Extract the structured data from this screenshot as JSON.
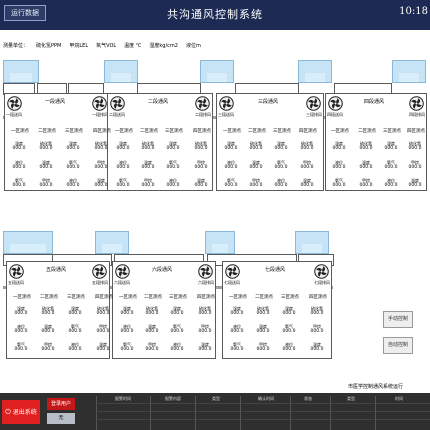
{
  "header": {
    "run_data_label": "运行数据",
    "title": "共沟通风控制系统",
    "clock": "10:18"
  },
  "units": [
    "测量单位：",
    "硫化氢PPM",
    "甲烷LEL",
    "氧气VOL",
    "温度 ℃",
    "湿度kg/cm2",
    "液位m"
  ],
  "top_sections": [
    {
      "title": "一段通风",
      "fan_left": "一段送风",
      "fan_right": "一段排风"
    },
    {
      "title": "二段通风",
      "fan_left": "二段送风",
      "fan_right": "二段排风"
    },
    {
      "title": "三段通风",
      "fan_left": "三段送风",
      "fan_right": "三段排风"
    },
    {
      "title": "四段通风",
      "fan_left": "四段送风",
      "fan_right": "四段排风"
    }
  ],
  "bottom_sections": [
    {
      "title": "五段通风",
      "fan_left": "五段送风",
      "fan_right": "五段排风"
    },
    {
      "title": "六段通风",
      "fan_left": "六段送风",
      "fan_right": "六段排风"
    },
    {
      "title": "七段通风",
      "fan_left": "七段送风",
      "fan_right": "七段排风"
    }
  ],
  "sensor_headers": [
    "一区测点",
    "二区测点",
    "三区测点",
    "四区测点"
  ],
  "sensor_labels": [
    "液位",
    "温度",
    "氧气",
    "甲烷"
  ],
  "sensor_labels_alt": [
    "湿度",
    "硫化氢"
  ],
  "sensor_value": "000.0",
  "side_buttons": [
    "手动控制",
    "自动控制"
  ],
  "ticker": "市医学控制通风系统运行",
  "footer": {
    "exit_label": "退出系统",
    "login_label": "登录用户",
    "user_value": "无",
    "alarm_headers": [
      "报警时间",
      "报警内容",
      "类型",
      "确认时间",
      "状态",
      "类型",
      "时间"
    ]
  },
  "colors": {
    "topbar": "#1d2b54",
    "vent": "#c7e3f6",
    "exit": "#e02020",
    "footer": "#2f2f2f"
  }
}
